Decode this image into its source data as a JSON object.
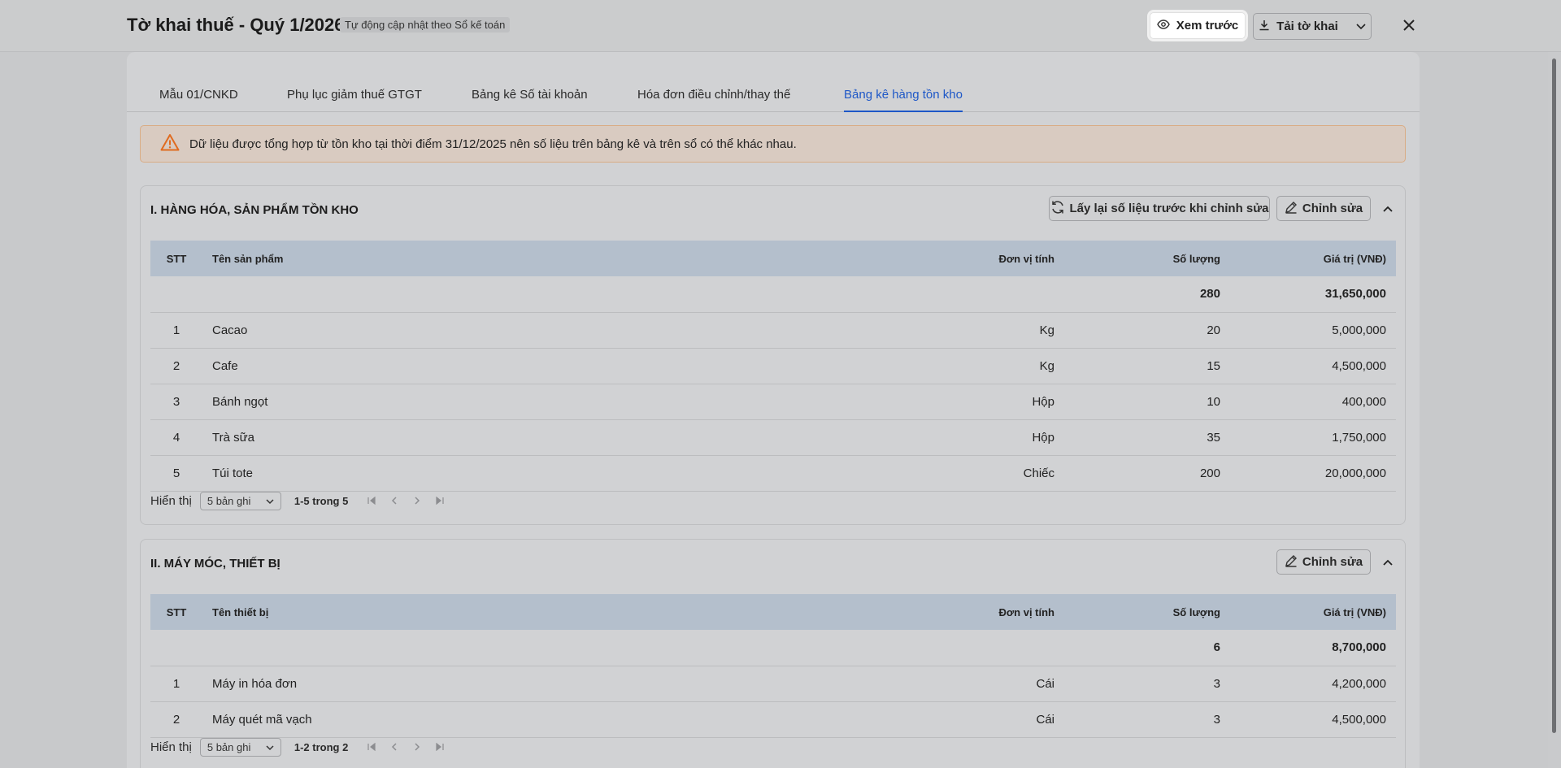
{
  "header": {
    "title": "Tờ khai thuế - Quý 1/2026",
    "badge": "Tự động cập nhật theo Sổ kế toán",
    "preview_label": "Xem trước",
    "download_label": "Tải tờ khai"
  },
  "tabs": [
    {
      "label": "Mẫu 01/CNKD"
    },
    {
      "label": "Phụ lục giảm thuế GTGT"
    },
    {
      "label": "Bảng kê Số tài khoản"
    },
    {
      "label": "Hóa đơn điều chỉnh/thay thế"
    },
    {
      "label": "Bảng kê hàng tồn kho"
    }
  ],
  "active_tab": "Bảng kê hàng tồn kho",
  "alert": {
    "text": "Dữ liệu được tổng hợp từ tồn kho tại thời điểm 31/12/2025 nên số liệu trên bảng kê và trên sổ có thể khác nhau."
  },
  "section1": {
    "title": "I. HÀNG HÓA, SẢN PHẨM TỒN KHO",
    "reload_label": "Lấy lại số liệu trước khi chỉnh sửa",
    "edit_label": "Chỉnh sửa",
    "columns": [
      "STT",
      "Tên sản phẩm",
      "Đơn vị tính",
      "Số lượng",
      "Giá trị (VNĐ)"
    ],
    "total": {
      "qty": "280",
      "value": "31,650,000"
    },
    "rows": [
      {
        "stt": "1",
        "name": "Cacao",
        "unit": "Kg",
        "qty": "20",
        "value": "5,000,000"
      },
      {
        "stt": "2",
        "name": "Cafe",
        "unit": "Kg",
        "qty": "15",
        "value": "4,500,000"
      },
      {
        "stt": "3",
        "name": "Bánh ngọt",
        "unit": "Hộp",
        "qty": "10",
        "value": "400,000"
      },
      {
        "stt": "4",
        "name": "Trà sữa",
        "unit": "Hộp",
        "qty": "35",
        "value": "1,750,000"
      },
      {
        "stt": "5",
        "name": "Túi tote",
        "unit": "Chiếc",
        "qty": "200",
        "value": "20,000,000"
      }
    ],
    "pager": {
      "show_label": "Hiển thị",
      "page_size": "5 bản ghi",
      "range": "1-5 trong 5"
    }
  },
  "section2": {
    "title": "II. MÁY MÓC, THIẾT BỊ",
    "edit_label": "Chỉnh sửa",
    "columns": [
      "STT",
      "Tên thiết bị",
      "Đơn vị tính",
      "Số lượng",
      "Giá trị (VNĐ)"
    ],
    "total": {
      "qty": "6",
      "value": "8,700,000"
    },
    "rows": [
      {
        "stt": "1",
        "name": "Máy in hóa đơn",
        "unit": "Cái",
        "qty": "3",
        "value": "4,200,000"
      },
      {
        "stt": "2",
        "name": "Máy quét mã vạch",
        "unit": "Cái",
        "qty": "3",
        "value": "4,500,000"
      }
    ],
    "pager": {
      "show_label": "Hiển thị",
      "page_size": "5 bản ghi",
      "range": "1-2 trong 2"
    }
  },
  "colors": {
    "accent": "#1d57c7",
    "warning": "#e06b1f"
  }
}
